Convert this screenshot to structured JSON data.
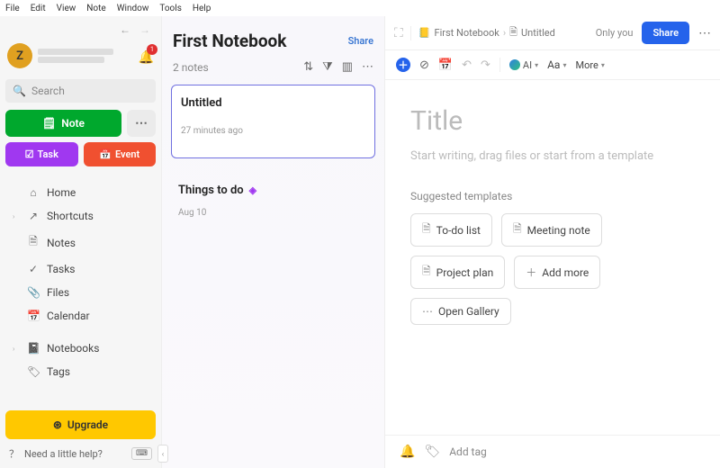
{
  "menu": {
    "items": [
      "File",
      "Edit",
      "View",
      "Note",
      "Window",
      "Tools",
      "Help"
    ]
  },
  "sidebar": {
    "avatar_letter": "Z",
    "notification_count": "1",
    "search_placeholder": "Search",
    "new_note_label": "Note",
    "task_label": "Task",
    "event_label": "Event",
    "nav1": [
      {
        "icon": "⌂",
        "label": "Home"
      },
      {
        "icon": "↗",
        "label": "Shortcuts",
        "expandable": true
      },
      {
        "icon": "🗎",
        "label": "Notes"
      },
      {
        "icon": "✓",
        "label": "Tasks"
      },
      {
        "icon": "📎",
        "label": "Files"
      },
      {
        "icon": "📅",
        "label": "Calendar"
      }
    ],
    "nav2": [
      {
        "icon": "📓",
        "label": "Notebooks",
        "expandable": true
      },
      {
        "icon": "🏷",
        "label": "Tags"
      }
    ],
    "upgrade_label": "Upgrade",
    "help_label": "Need a little help?"
  },
  "notelist": {
    "title": "First Notebook",
    "share_label": "Share",
    "count_label": "2 notes",
    "notes": [
      {
        "title": "Untitled",
        "time": "27 minutes ago",
        "selected": true
      },
      {
        "title": "Things to do",
        "time": "Aug 10",
        "shortcut": true
      }
    ]
  },
  "editor": {
    "breadcrumb_notebook": "First Notebook",
    "breadcrumb_note": "Untitled",
    "onlyyou": "Only you",
    "share_label": "Share",
    "ai_label": "AI",
    "aa_label": "Aa",
    "more_label": "More",
    "title_placeholder": "Title",
    "body_placeholder": "Start writing, drag files or start from a template",
    "suggested_label": "Suggested templates",
    "templates_row1": [
      {
        "label": "To-do list",
        "icon": "🗎"
      },
      {
        "label": "Meeting note",
        "icon": "🗎"
      }
    ],
    "templates_row2": [
      {
        "label": "Project plan",
        "icon": "🗎"
      },
      {
        "label": "Add more",
        "icon": "＋"
      }
    ],
    "gallery_label": "Open Gallery",
    "addtag_label": "Add tag"
  }
}
